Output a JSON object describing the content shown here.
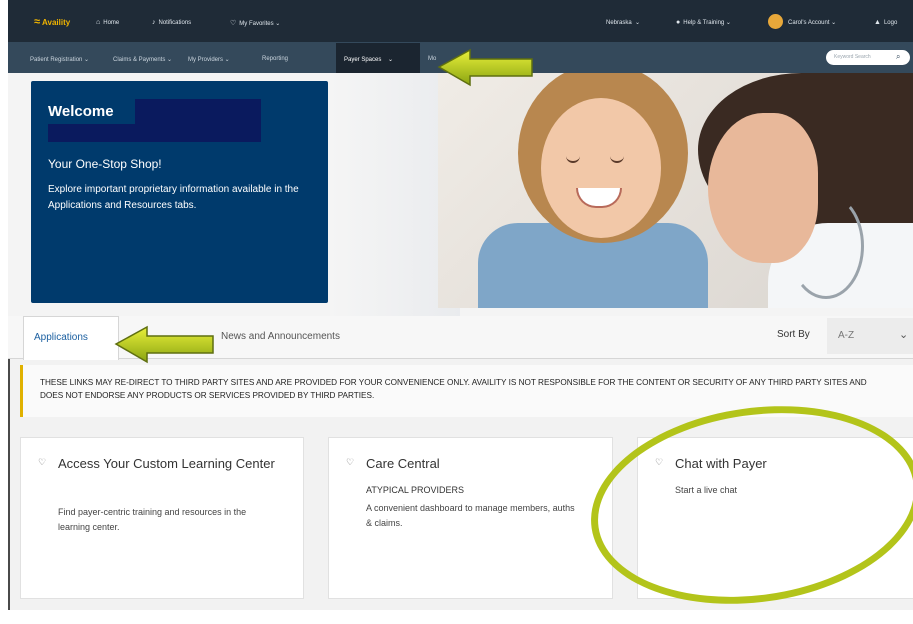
{
  "topbar": {
    "brand": "Availity",
    "home": "Home",
    "notifications": "Notifications",
    "favorites": "My Favorites",
    "state": "Nebraska",
    "help": "Help & Training",
    "account": "Carol's Account",
    "logout": "Logo"
  },
  "nav": {
    "items": [
      "Patient Registration",
      "Claims & Payments",
      "My Providers",
      "Reporting",
      "Payer Spaces",
      "Mo"
    ],
    "search_placeholder": "Keyword Search"
  },
  "welcome": {
    "title": "Welcome",
    "subtitle": "Your One-Stop Shop!",
    "description": "Explore important proprietary information available in the Applications and Resources tabs."
  },
  "tabs": {
    "applications": "Applications",
    "news": "News and Announcements",
    "sort_label": "Sort By",
    "sort_value": "A-Z"
  },
  "disclaimer": "THESE LINKS MAY RE-DIRECT TO THIRD PARTY SITES AND ARE PROVIDED FOR YOUR CONVENIENCE ONLY. AVAILITY IS NOT RESPONSIBLE FOR THE CONTENT OR SECURITY OF ANY THIRD PARTY SITES AND DOES NOT ENDORSE ANY PRODUCTS OR SERVICES PROVIDED BY THIRD PARTIES.",
  "cards": [
    {
      "title": "Access Your Custom Learning Center",
      "subtitle": "",
      "body": "Find payer-centric training and resources in the learning center."
    },
    {
      "title": "Care Central",
      "subtitle": "ATYPICAL PROVIDERS",
      "body": "A convenient dashboard to manage members, auths & claims."
    },
    {
      "title": "Chat with Payer",
      "subtitle": "",
      "body": "Start a live chat"
    }
  ],
  "colors": {
    "topbar": "#1f2b37",
    "navbar": "#34495b",
    "welcome_panel": "#003a6c",
    "link": "#1b5fa0",
    "annotation": "#b3c41a"
  }
}
